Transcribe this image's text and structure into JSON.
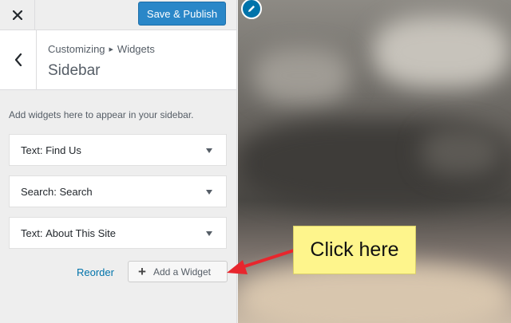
{
  "header": {
    "save_label": "Save & Publish",
    "close_icon": "close-icon"
  },
  "title_section": {
    "breadcrumb": [
      "Customizing",
      "Widgets"
    ],
    "title": "Sidebar"
  },
  "description": "Add widgets here to appear in your sidebar.",
  "widgets": [
    {
      "type": "Text:",
      "name": "Find Us"
    },
    {
      "type": "Search:",
      "name": "Search"
    },
    {
      "type": "Text:",
      "name": "About This Site"
    }
  ],
  "actions": {
    "reorder_label": "Reorder",
    "add_widget_label": "Add a Widget"
  },
  "annotation": {
    "callout_text": "Click here",
    "callout_color": "#fef58c",
    "arrow_color": "#e8262d"
  },
  "colors": {
    "primary_button": "#2a87c8",
    "link": "#0073aa",
    "edit_shortcut": "#0073aa"
  }
}
